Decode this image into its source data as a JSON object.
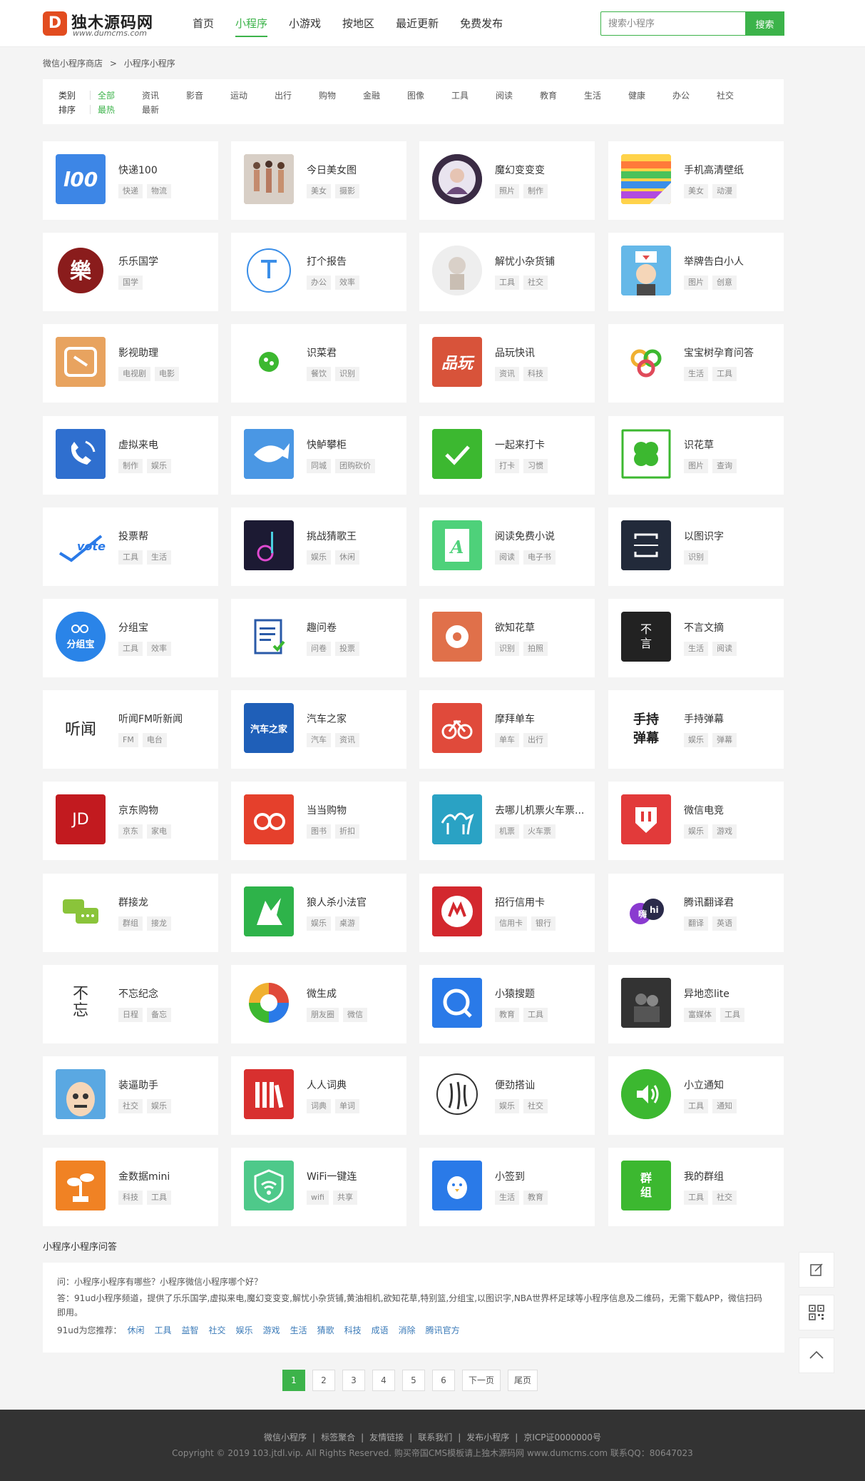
{
  "header": {
    "logo_title": "独木源码网",
    "logo_sub": "www.dumcms.com",
    "nav": [
      "首页",
      "小程序",
      "小游戏",
      "按地区",
      "最近更新",
      "免费发布"
    ],
    "active_nav": 1,
    "search_placeholder": "搜索小程序",
    "search_button": "搜索"
  },
  "breadcrumb": [
    "微信小程序商店",
    ">",
    "小程序小程序"
  ],
  "filters": {
    "category_label": "类别",
    "categories": [
      "全部",
      "资讯",
      "影音",
      "运动",
      "出行",
      "购物",
      "金融",
      "图像",
      "工具",
      "阅读",
      "教育",
      "生活",
      "健康",
      "办公",
      "社交"
    ],
    "sort_label": "排序",
    "sorts": [
      "最热",
      "最新"
    ]
  },
  "apps": [
    {
      "name": "快递100",
      "tags": [
        "快递",
        "物流"
      ],
      "icon": "kuaidi100-icon",
      "color": "#3d86e6"
    },
    {
      "name": "今日美女图",
      "tags": [
        "美女",
        "摄影"
      ],
      "icon": "photo-girls-icon",
      "color": "#b89a84"
    },
    {
      "name": "魔幻变变变",
      "tags": [
        "照片",
        "制作"
      ],
      "icon": "portrait-round-icon",
      "color": "#3a2b44"
    },
    {
      "name": "手机高清壁纸",
      "tags": [
        "美女",
        "动漫"
      ],
      "icon": "rainbow-paper-icon",
      "color": "#e5b530"
    },
    {
      "name": "乐乐国学",
      "tags": [
        "国学"
      ],
      "icon": "yue-seal-icon",
      "color": "#ffffff"
    },
    {
      "name": "打个报告",
      "tags": [
        "办公",
        "效率"
      ],
      "icon": "t-circle-icon",
      "color": "#ffffff"
    },
    {
      "name": "解忧小杂货铺",
      "tags": [
        "工具",
        "社交"
      ],
      "icon": "sketch-boy-icon",
      "color": "#eeeeee"
    },
    {
      "name": "举牌告白小人",
      "tags": [
        "图片",
        "创意"
      ],
      "icon": "sign-boy-icon",
      "color": "#65b8e8"
    },
    {
      "name": "影视助理",
      "tags": [
        "电视剧",
        "电影"
      ],
      "icon": "film-icon",
      "color": "#e29a57"
    },
    {
      "name": "识菜君",
      "tags": [
        "餐饮",
        "识别"
      ],
      "icon": "veggie-icon",
      "color": "#ffffff"
    },
    {
      "name": "品玩快讯",
      "tags": [
        "资讯",
        "科技"
      ],
      "icon": "pinwan-icon",
      "color": "#d8533a"
    },
    {
      "name": "宝宝树孕育问答",
      "tags": [
        "生活",
        "工具"
      ],
      "icon": "babytree-icon",
      "color": "#ffffff"
    },
    {
      "name": "虚拟来电",
      "tags": [
        "制作",
        "娱乐"
      ],
      "icon": "phone-icon",
      "color": "#2f6fcf"
    },
    {
      "name": "快鲈攀柜",
      "tags": [
        "同城",
        "团购砍价"
      ],
      "icon": "fish-icon",
      "color": "#4a97e4"
    },
    {
      "name": "一起来打卡",
      "tags": [
        "打卡",
        "习惯"
      ],
      "icon": "check-icon",
      "color": "#3cb830"
    },
    {
      "name": "识花草",
      "tags": [
        "图片",
        "查询"
      ],
      "icon": "clover-icon",
      "color": "#ffffff"
    },
    {
      "name": "投票帮",
      "tags": [
        "工具",
        "生活"
      ],
      "icon": "vote-icon",
      "color": "#ffffff"
    },
    {
      "name": "挑战猜歌王",
      "tags": [
        "娱乐",
        "休闲"
      ],
      "icon": "music-note-icon",
      "color": "#1c1a33"
    },
    {
      "name": "阅读免费小说",
      "tags": [
        "阅读",
        "电子书"
      ],
      "icon": "book-a-icon",
      "color": "#4ed17a"
    },
    {
      "name": "以图识字",
      "tags": [
        "识别"
      ],
      "icon": "scan-frame-icon",
      "color": "#222a3a"
    },
    {
      "name": "分组宝",
      "tags": [
        "工具",
        "效率"
      ],
      "icon": "group-icon",
      "color": "#2a84e8"
    },
    {
      "name": "趣问卷",
      "tags": [
        "问卷",
        "投票"
      ],
      "icon": "survey-icon",
      "color": "#ffffff"
    },
    {
      "name": "欲知花草",
      "tags": [
        "识别",
        "拍照"
      ],
      "icon": "flower-icon",
      "color": "#e0704a"
    },
    {
      "name": "不言文摘",
      "tags": [
        "生活",
        "阅读"
      ],
      "icon": "buyan-icon",
      "color": "#222222"
    },
    {
      "name": "听闻FM听新闻",
      "tags": [
        "FM",
        "电台"
      ],
      "icon": "tingwen-icon",
      "color": "#ffffff"
    },
    {
      "name": "汽车之家",
      "tags": [
        "汽车",
        "资讯"
      ],
      "icon": "autohome-icon",
      "color": "#1f5fb8"
    },
    {
      "name": "摩拜单车",
      "tags": [
        "单车",
        "出行"
      ],
      "icon": "bike-icon",
      "color": "#e04a3b"
    },
    {
      "name": "手持弹幕",
      "tags": [
        "娱乐",
        "弹幕"
      ],
      "icon": "danmu-icon",
      "color": "#ffffff"
    },
    {
      "name": "京东购物",
      "tags": [
        "京东",
        "家电"
      ],
      "icon": "jd-icon",
      "color": "#c21a1f"
    },
    {
      "name": "当当购物",
      "tags": [
        "图书",
        "折扣"
      ],
      "icon": "dangdang-icon",
      "color": "#e5402c"
    },
    {
      "name": "去哪儿机票火车票...",
      "tags": [
        "机票",
        "火车票"
      ],
      "icon": "camel-icon",
      "color": "#2aa2c4"
    },
    {
      "name": "微信电竞",
      "tags": [
        "娱乐",
        "游戏"
      ],
      "icon": "esports-icon",
      "color": "#e23a3a"
    },
    {
      "name": "群接龙",
      "tags": [
        "群组",
        "接龙"
      ],
      "icon": "chat-bubbles-icon",
      "color": "#ffffff"
    },
    {
      "name": "狼人杀小法官",
      "tags": [
        "娱乐",
        "桌游"
      ],
      "icon": "wolf-icon",
      "color": "#2eb34a"
    },
    {
      "name": "招行信用卡",
      "tags": [
        "信用卡",
        "银行"
      ],
      "icon": "cmb-icon",
      "color": "#d3282e"
    },
    {
      "name": "腾讯翻译君",
      "tags": [
        "翻译",
        "英语"
      ],
      "icon": "translate-icon",
      "color": "#ffffff"
    },
    {
      "name": "不忘纪念",
      "tags": [
        "日程",
        "备忘"
      ],
      "icon": "buwang-icon",
      "color": "#ffffff"
    },
    {
      "name": "微生成",
      "tags": [
        "朋友圈",
        "微信"
      ],
      "icon": "aperture-icon",
      "color": "#ffffff"
    },
    {
      "name": "小猿搜题",
      "tags": [
        "教育",
        "工具"
      ],
      "icon": "search-q-icon",
      "color": "#2a7ae8"
    },
    {
      "name": "异地恋lite",
      "tags": [
        "富媒体",
        "工具"
      ],
      "icon": "couple-photo-icon",
      "color": "#333333"
    },
    {
      "name": "装逼助手",
      "tags": [
        "社交",
        "娱乐"
      ],
      "icon": "cartoon-face-icon",
      "color": "#5aa8e2"
    },
    {
      "name": "人人词典",
      "tags": [
        "词典",
        "单词"
      ],
      "icon": "dictionary-icon",
      "color": "#d8302f"
    },
    {
      "name": "便劲搭讪",
      "tags": [
        "娱乐",
        "社交"
      ],
      "icon": "calligraphy-icon",
      "color": "#ffffff"
    },
    {
      "name": "小立通知",
      "tags": [
        "工具",
        "通知"
      ],
      "icon": "speaker-icon",
      "color": "#3cb830"
    },
    {
      "name": "金数据mini",
      "tags": [
        "科技",
        "工具"
      ],
      "icon": "sprout-icon",
      "color": "#f08224"
    },
    {
      "name": "WiFi一键连",
      "tags": [
        "wifi",
        "共享"
      ],
      "icon": "wifi-shield-icon",
      "color": "#4ec98a"
    },
    {
      "name": "小签到",
      "tags": [
        "生活",
        "教育"
      ],
      "icon": "bird-icon",
      "color": "#2a7ae8"
    },
    {
      "name": "我的群组",
      "tags": [
        "工具",
        "社交"
      ],
      "icon": "qunzu-icon",
      "color": "#3cb830"
    }
  ],
  "faq": {
    "title": "小程序小程序问答",
    "question": "问：小程序小程序有哪些？小程序微信小程序哪个好？",
    "answer": "答：91ud小程序频道，提供了乐乐国学,虚拟来电,魔幻变变变,解忧小杂货铺,黄油相机,欲知花草,特别篮,分组宝,以图识字,NBA世界杯足球等小程序信息及二维码，无需下载APP，微信扫码即用。",
    "recommend_label": "91ud为您推荐：",
    "recommend": [
      "休闲",
      "工具",
      "益智",
      "社交",
      "娱乐",
      "游戏",
      "生活",
      "猜歌",
      "科技",
      "成语",
      "消除",
      "腾讯官方"
    ]
  },
  "pagination": [
    "1",
    "2",
    "3",
    "4",
    "5",
    "6",
    "下一页",
    "尾页"
  ],
  "side_tools": [
    "edit-icon",
    "qr-code-icon",
    "back-to-top-icon"
  ],
  "footer": {
    "links": [
      "微信小程序",
      "标签聚合",
      "友情链接",
      "联系我们",
      "发布小程序",
      "京ICP证0000000号"
    ],
    "copyright": "Copyright © 2019 103.jtdl.vip. All Rights Reserved. 购买帝国CMS模板请上独木源码网 www.dumcms.com 联系QQ：80647023"
  },
  "accent_color": "#3cb34a"
}
